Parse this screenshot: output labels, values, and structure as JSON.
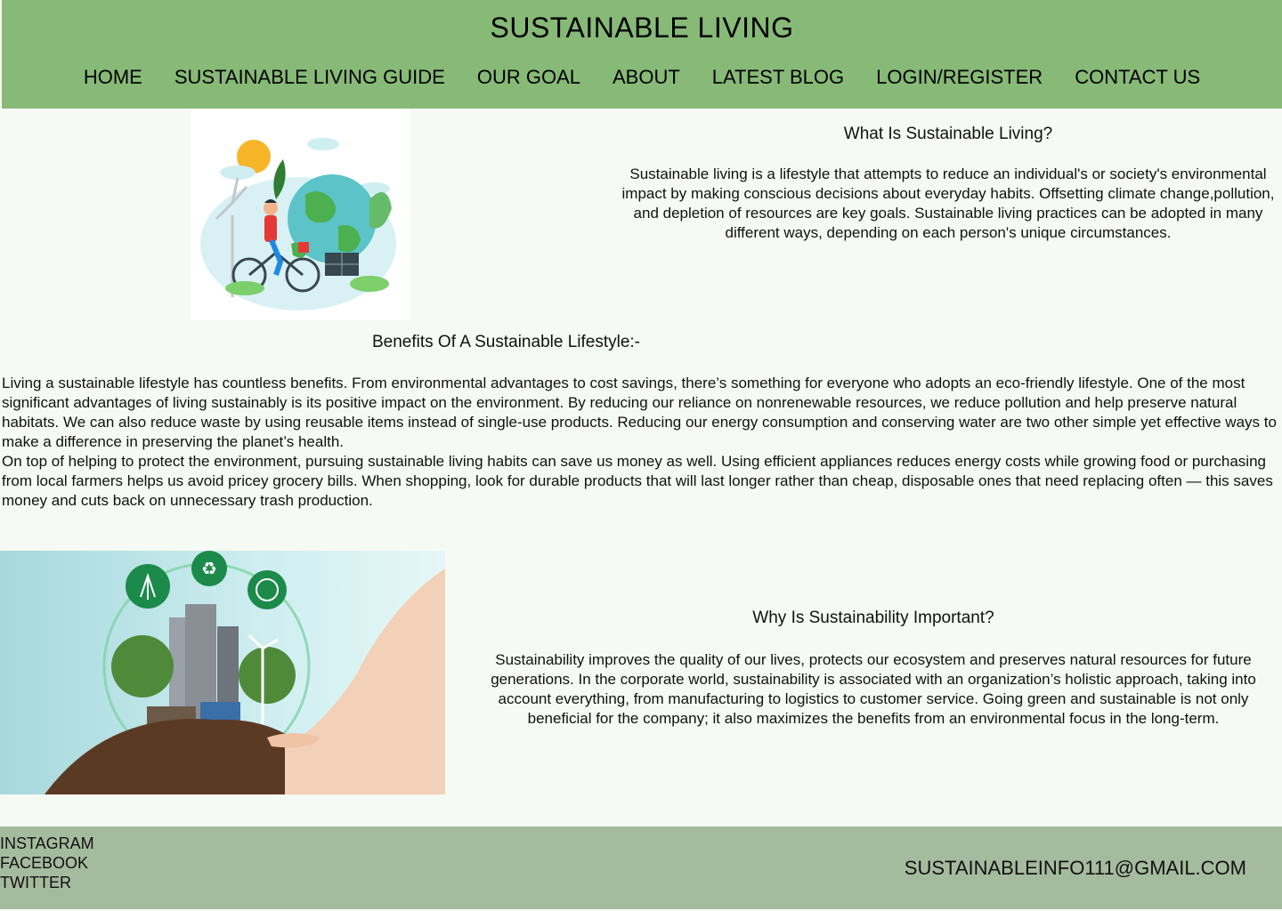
{
  "header": {
    "title": "SUSTAINABLE LIVING",
    "nav": [
      {
        "label": "HOME"
      },
      {
        "label": "SUSTAINABLE LIVING GUIDE"
      },
      {
        "label": "OUR GOAL"
      },
      {
        "label": "ABOUT"
      },
      {
        "label": "LATEST BLOG"
      },
      {
        "label": "LOGIN/REGISTER"
      },
      {
        "label": "CONTACT US"
      }
    ],
    "bg_color": "#87b977"
  },
  "intro": {
    "heading": "What Is Sustainable Living?",
    "body": "Sustainable living is a lifestyle that attempts to reduce an individual's or society's environmental impact by making conscious decisions about everyday habits. Offsetting climate change,pollution, and depletion of resources are key goals. Sustainable living practices can be adopted in many different ways, depending on each person's unique circumstances."
  },
  "benefits": {
    "heading": "Benefits Of A Sustainable Lifestyle:-",
    "paragraphs": [
      "Living a sustainable lifestyle has countless benefits. From environmental advantages to cost savings, there’s something for everyone who adopts an eco-friendly lifestyle. One of the most significant advantages of living sustainably is its positive impact on the environment. By reducing our reliance on nonrenewable resources, we reduce pollution and help preserve natural habitats. We can also reduce waste by using reusable items instead of single-use products. Reducing our energy consumption and conserving water are two other simple yet effective ways to make a difference in preserving the planet’s health.",
      "On top of helping to protect the environment, pursuing sustainable living habits can save us money as well. Using efficient appliances reduces energy costs while growing food or purchasing from local farmers helps us avoid pricey grocery bills. When shopping, look for durable products that will last longer rather than cheap, disposable ones that need replacing often — this saves money and cuts back on unnecessary trash production."
    ]
  },
  "importance": {
    "heading": "Why Is Sustainability Important?",
    "body": "Sustainability improves the quality of our lives, protects our ecosystem and preserves natural resources for future generations. In the corporate world, sustainability is associated with an organization’s holistic approach, taking into account everything, from manufacturing to logistics to customer service. Going green and sustainable is not only beneficial for the company; it also maximizes the benefits from an environmental focus in the long-term."
  },
  "footer": {
    "social": [
      {
        "label": "INSTAGRAM"
      },
      {
        "label": "FACEBOOK"
      },
      {
        "label": "TWITTER"
      }
    ],
    "email": "SUSTAINABLEINFO111@GMAIL.COM",
    "bg_color": "#a5bb9e"
  }
}
